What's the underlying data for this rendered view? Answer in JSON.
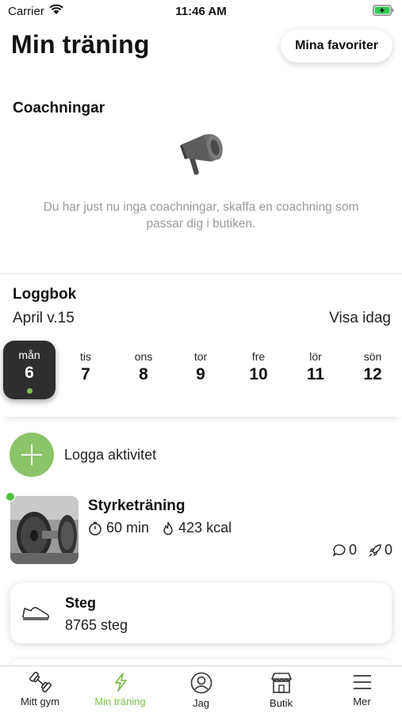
{
  "status_bar": {
    "carrier": "Carrier",
    "time": "11:46 AM"
  },
  "header": {
    "title": "Min träning",
    "favorites_label": "Mina favoriter"
  },
  "coaching": {
    "title": "Coachningar",
    "icon": "megaphone-icon",
    "empty_text": "Du har just nu inga coachningar, skaffa en coachning som passar dig i butiken."
  },
  "logbook": {
    "title": "Loggbok",
    "week": "April v.15",
    "today_label": "Visa idag",
    "days": [
      {
        "name": "mån",
        "num": "6",
        "selected": true,
        "has_activity": true
      },
      {
        "name": "tis",
        "num": "7"
      },
      {
        "name": "ons",
        "num": "8"
      },
      {
        "name": "tor",
        "num": "9"
      },
      {
        "name": "fre",
        "num": "10"
      },
      {
        "name": "lör",
        "num": "11"
      },
      {
        "name": "sön",
        "num": "12"
      }
    ]
  },
  "log_activity": {
    "label": "Logga aktivitet"
  },
  "workout": {
    "name": "Styrketräning",
    "duration": "60 min",
    "calories": "423 kcal",
    "comments": "0",
    "boosts": "0"
  },
  "steps": {
    "title": "Steg",
    "value": "8765 steg"
  },
  "tabs": [
    {
      "label": "Mitt gym",
      "icon": "dumbbell-icon"
    },
    {
      "label": "Min träning",
      "icon": "lightning-icon",
      "active": true
    },
    {
      "label": "Jag",
      "icon": "person-icon"
    },
    {
      "label": "Butik",
      "icon": "store-icon"
    },
    {
      "label": "Mer",
      "icon": "menu-icon"
    }
  ],
  "colors": {
    "accent": "#7cc04a",
    "activity_dot": "#52c041",
    "text_muted": "#9a9a9a"
  }
}
